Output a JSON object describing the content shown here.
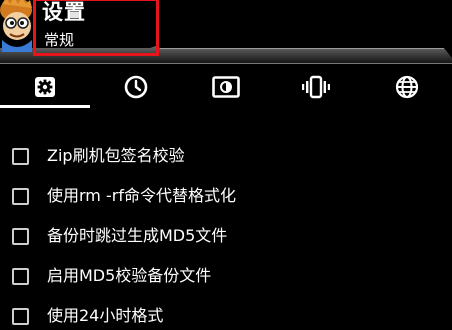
{
  "header": {
    "title": "设置",
    "subtitle": "常规",
    "highlight_color": "#e8141c"
  },
  "tabs": [
    {
      "id": "general",
      "icon": "gear-icon",
      "selected": true
    },
    {
      "id": "time",
      "icon": "clock-icon",
      "selected": false
    },
    {
      "id": "display",
      "icon": "brightness-icon",
      "selected": false
    },
    {
      "id": "vibration",
      "icon": "vibration-icon",
      "selected": false
    },
    {
      "id": "language",
      "icon": "globe-icon",
      "selected": false
    }
  ],
  "options": [
    {
      "label": "Zip刷机包签名校验",
      "checked": false
    },
    {
      "label": "使用rm -rf命令代替格式化",
      "checked": false
    },
    {
      "label": "备份时跳过生成MD5文件",
      "checked": false
    },
    {
      "label": "启用MD5校验备份文件",
      "checked": false
    },
    {
      "label": "使用24小时格式",
      "checked": false
    }
  ]
}
